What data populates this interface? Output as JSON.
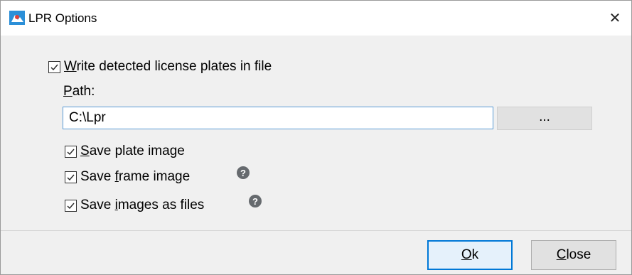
{
  "window": {
    "title": "LPR Options",
    "close_glyph": "✕"
  },
  "icons": {
    "app": "lpr-app-icon",
    "close": "close-icon",
    "help": "help-circle-icon",
    "check": "checkmark-icon"
  },
  "options": {
    "write_plates": {
      "label_pre": "",
      "label_key": "W",
      "label_post": "rite detected license plates in file",
      "checked": true
    },
    "path_label_key": "P",
    "path_label_post": "ath:",
    "path_value": "C:\\Lpr",
    "browse_label": "...",
    "save_plate": {
      "label_pre": "",
      "label_key": "S",
      "label_post": "ave plate image",
      "checked": true
    },
    "save_frame": {
      "label_pre": "Save ",
      "label_key": "f",
      "label_post": "rame image",
      "checked": true
    },
    "save_files": {
      "label_pre": "Save ",
      "label_key": "i",
      "label_post": "mages as files",
      "checked": true
    },
    "help_glyph": "?"
  },
  "buttons": {
    "ok_key": "O",
    "ok_post": "k",
    "close_key": "C",
    "close_post": "lose"
  },
  "colors": {
    "accent": "#0078d7",
    "help": "#666a6e"
  }
}
